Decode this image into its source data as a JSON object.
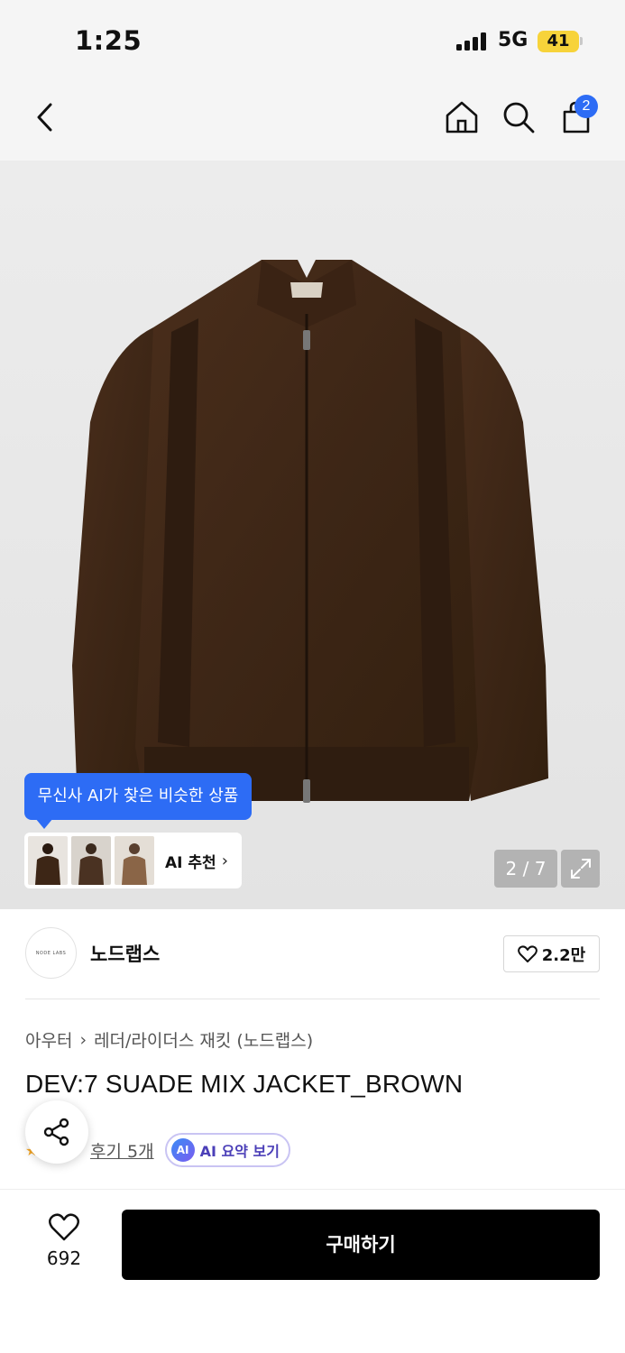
{
  "status_bar": {
    "time": "1:25",
    "network": "5G",
    "battery": "41"
  },
  "nav": {
    "back_icon": "chevron-left-icon",
    "home_icon": "home-icon",
    "search_icon": "search-icon",
    "cart_icon": "shopping-bag-icon",
    "cart_badge": "2"
  },
  "gallery": {
    "ai_tooltip": "무신사 AI가 찾은 비슷한 상품",
    "ai_recommend_label": "AI 추천",
    "counter": "2 / 7",
    "expand_icon": "expand-icon"
  },
  "brand": {
    "logo_text": "NODE LABS",
    "name": "노드랩스",
    "likes": "2.2만"
  },
  "breadcrumb": {
    "items": [
      "아우터",
      "레더/라이더스 재킷 (노드랩스)"
    ]
  },
  "product": {
    "title": "DEV:7 SUADE MIX JACKET_BROWN",
    "review_link": "후기 5개",
    "ai_summary_badge": "AI",
    "ai_summary_label": "AI 요약 보기"
  },
  "bottom": {
    "wish_count": "692",
    "buy_label": "구매하기"
  },
  "colors": {
    "accent": "#2d6cf5",
    "buy_button": "#000000",
    "jacket": "#3d2616"
  }
}
